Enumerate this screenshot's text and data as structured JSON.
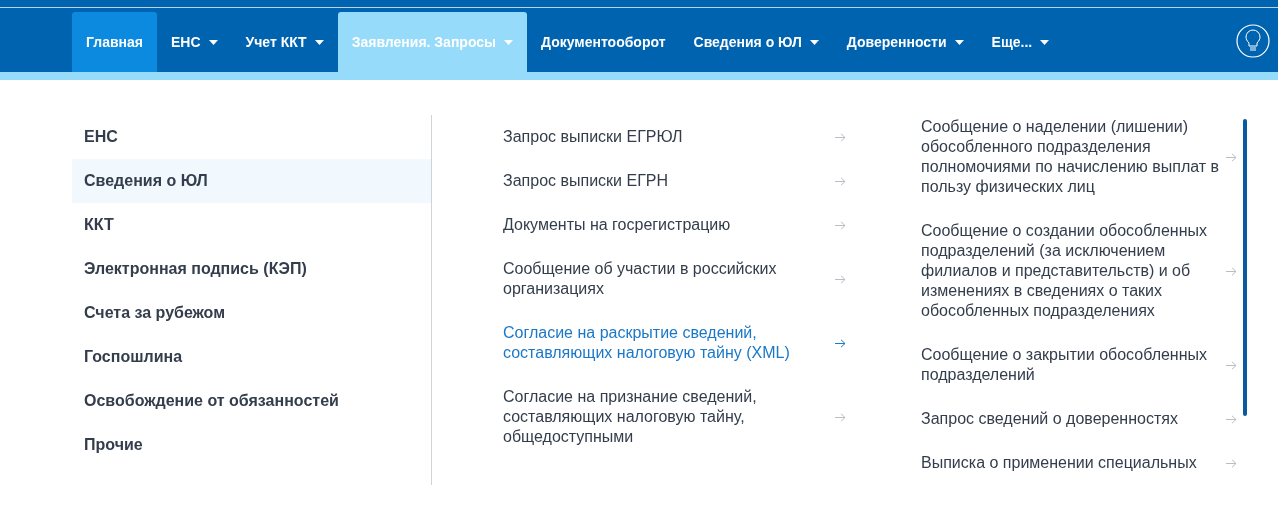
{
  "nav": {
    "tabs": [
      {
        "label": "Главная",
        "selected": true,
        "expanded": false,
        "has_menu": false
      },
      {
        "label": "ЕНС",
        "selected": false,
        "expanded": false,
        "has_menu": true
      },
      {
        "label": "Учет ККТ",
        "selected": false,
        "expanded": false,
        "has_menu": true
      },
      {
        "label": "Заявления. Запросы",
        "selected": false,
        "expanded": true,
        "has_menu": true
      },
      {
        "label": "Документооборот",
        "selected": false,
        "expanded": false,
        "has_menu": false
      },
      {
        "label": "Сведения о ЮЛ",
        "selected": false,
        "expanded": false,
        "has_menu": true
      },
      {
        "label": "Доверенности",
        "selected": false,
        "expanded": false,
        "has_menu": true
      },
      {
        "label": "Еще...",
        "selected": false,
        "expanded": false,
        "has_menu": true
      }
    ]
  },
  "menu": {
    "categories": [
      {
        "label": "ЕНС",
        "selected": false
      },
      {
        "label": "Сведения о ЮЛ",
        "selected": true
      },
      {
        "label": "ККТ",
        "selected": false
      },
      {
        "label": "Электронная подпись (КЭП)",
        "selected": false
      },
      {
        "label": "Счета за рубежом",
        "selected": false
      },
      {
        "label": "Госпошлина",
        "selected": false
      },
      {
        "label": "Освобождение от обязанностей",
        "selected": false
      },
      {
        "label": "Прочие",
        "selected": false
      }
    ],
    "column_2": [
      {
        "label": "Запрос выписки ЕГРЮЛ",
        "selected": false
      },
      {
        "label": "Запрос выписки ЕГРН",
        "selected": false
      },
      {
        "label": "Документы на госрегистрацию",
        "selected": false
      },
      {
        "label": "Сообщение об участии в российских организациях",
        "selected": false
      },
      {
        "label": "Согласие на раскрытие сведений, составляющих налоговую тайну (XML)",
        "selected": true
      },
      {
        "label": "Согласие на признание сведений, составляющих налоговую тайну, общедоступными",
        "selected": false
      }
    ],
    "column_3": [
      {
        "label": "Сообщение о наделении (лишении) обособленного подразделения полномочиями по начислению выплат в пользу физических лиц",
        "selected": false
      },
      {
        "label": "Сообщение о создании обособленных подразделений (за исключением филиалов и представительств) и об изменениях в сведениях о таких обособленных подразделениях",
        "selected": false
      },
      {
        "label": "Сообщение о закрытии обособленных подразделений",
        "selected": false
      },
      {
        "label": "Запрос сведений о доверенностях",
        "selected": false
      },
      {
        "label": "Выписка о применении специальных",
        "selected": false
      }
    ]
  }
}
